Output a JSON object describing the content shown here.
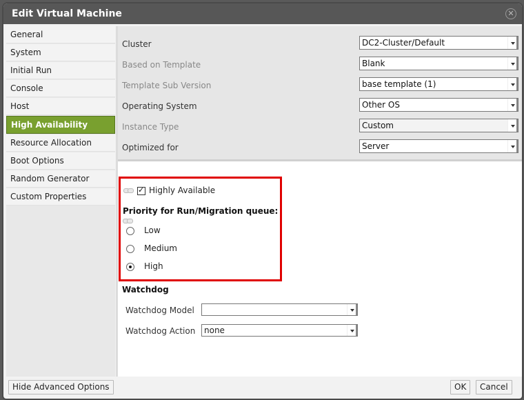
{
  "window": {
    "title": "Edit Virtual Machine",
    "close_icon": "close-circle-icon"
  },
  "sidebar": {
    "items": [
      {
        "label": "General",
        "active": false
      },
      {
        "label": "System",
        "active": false
      },
      {
        "label": "Initial Run",
        "active": false
      },
      {
        "label": "Console",
        "active": false
      },
      {
        "label": "Host",
        "active": false
      },
      {
        "label": "High Availability",
        "active": true
      },
      {
        "label": "Resource Allocation",
        "active": false
      },
      {
        "label": "Boot Options",
        "active": false
      },
      {
        "label": "Random Generator",
        "active": false
      },
      {
        "label": "Custom Properties",
        "active": false
      }
    ],
    "active_color": "#79a02f"
  },
  "general": {
    "fields": [
      {
        "label": "Cluster",
        "value": "DC2-Cluster/Default",
        "enabled": true
      },
      {
        "label": "Based on Template",
        "value": "Blank",
        "enabled": false
      },
      {
        "label": "Template Sub Version",
        "value": "base template (1)",
        "enabled": false
      },
      {
        "label": "Operating System",
        "value": "Other OS",
        "enabled": true
      },
      {
        "label": "Instance Type",
        "value": "Custom",
        "enabled": false
      },
      {
        "label": "Optimized for",
        "value": "Server",
        "enabled": true
      }
    ]
  },
  "high_availability": {
    "highly_available_label": "Highly Available",
    "highly_available_checked": true,
    "priority_label": "Priority for Run/Migration queue:",
    "priority_options": [
      "Low",
      "Medium",
      "High"
    ],
    "priority_selected": "High",
    "highlight_color": "#e00000"
  },
  "watchdog": {
    "title": "Watchdog",
    "model_label": "Watchdog Model",
    "model_value": "",
    "action_label": "Watchdog Action",
    "action_value": "none"
  },
  "footer": {
    "advanced_button": "Hide Advanced Options",
    "ok_button": "OK",
    "cancel_button": "Cancel"
  }
}
